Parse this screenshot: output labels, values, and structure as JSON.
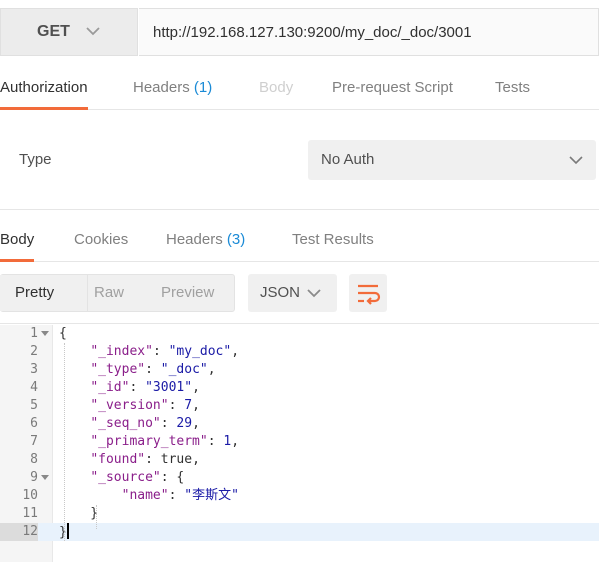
{
  "request": {
    "method": "GET",
    "url": "http://192.168.127.130:9200/my_doc/_doc/3001"
  },
  "request_tabs": [
    {
      "label": "Authorization",
      "count": "",
      "state": "active"
    },
    {
      "label": "Headers",
      "count": "(1)",
      "state": "normal"
    },
    {
      "label": "Body",
      "count": "",
      "state": "disabled"
    },
    {
      "label": "Pre-request Script",
      "count": "",
      "state": "normal"
    },
    {
      "label": "Tests",
      "count": "",
      "state": "normal"
    }
  ],
  "auth": {
    "type_label": "Type",
    "type_value": "No Auth"
  },
  "response_tabs": [
    {
      "label": "Body",
      "count": "",
      "state": "active"
    },
    {
      "label": "Cookies",
      "count": "",
      "state": "normal"
    },
    {
      "label": "Headers",
      "count": "(3)",
      "state": "normal"
    },
    {
      "label": "Test Results",
      "count": "",
      "state": "normal"
    }
  ],
  "toolbar": {
    "views": [
      "Pretty",
      "Raw",
      "Preview"
    ],
    "active_view": "Pretty",
    "format": "JSON",
    "wrap_icon": "wrap-lines-icon"
  },
  "response_body": {
    "lines": [
      {
        "n": "1",
        "fold": true,
        "tokens": [
          {
            "t": "{",
            "c": "b"
          }
        ]
      },
      {
        "n": "2",
        "fold": false,
        "tokens": [
          {
            "t": "    ",
            "c": "b"
          },
          {
            "t": "\"_index\"",
            "c": "k"
          },
          {
            "t": ": ",
            "c": "b"
          },
          {
            "t": "\"my_doc\"",
            "c": "s"
          },
          {
            "t": ",",
            "c": "b"
          }
        ]
      },
      {
        "n": "3",
        "fold": false,
        "tokens": [
          {
            "t": "    ",
            "c": "b"
          },
          {
            "t": "\"_type\"",
            "c": "k"
          },
          {
            "t": ": ",
            "c": "b"
          },
          {
            "t": "\"_doc\"",
            "c": "s"
          },
          {
            "t": ",",
            "c": "b"
          }
        ]
      },
      {
        "n": "4",
        "fold": false,
        "tokens": [
          {
            "t": "    ",
            "c": "b"
          },
          {
            "t": "\"_id\"",
            "c": "k"
          },
          {
            "t": ": ",
            "c": "b"
          },
          {
            "t": "\"3001\"",
            "c": "s"
          },
          {
            "t": ",",
            "c": "b"
          }
        ]
      },
      {
        "n": "5",
        "fold": false,
        "tokens": [
          {
            "t": "    ",
            "c": "b"
          },
          {
            "t": "\"_version\"",
            "c": "k"
          },
          {
            "t": ": ",
            "c": "b"
          },
          {
            "t": "7",
            "c": "n"
          },
          {
            "t": ",",
            "c": "b"
          }
        ]
      },
      {
        "n": "6",
        "fold": false,
        "tokens": [
          {
            "t": "    ",
            "c": "b"
          },
          {
            "t": "\"_seq_no\"",
            "c": "k"
          },
          {
            "t": ": ",
            "c": "b"
          },
          {
            "t": "29",
            "c": "n"
          },
          {
            "t": ",",
            "c": "b"
          }
        ]
      },
      {
        "n": "7",
        "fold": false,
        "tokens": [
          {
            "t": "    ",
            "c": "b"
          },
          {
            "t": "\"_primary_term\"",
            "c": "k"
          },
          {
            "t": ": ",
            "c": "b"
          },
          {
            "t": "1",
            "c": "n"
          },
          {
            "t": ",",
            "c": "b"
          }
        ]
      },
      {
        "n": "8",
        "fold": false,
        "tokens": [
          {
            "t": "    ",
            "c": "b"
          },
          {
            "t": "\"found\"",
            "c": "k"
          },
          {
            "t": ": ",
            "c": "b"
          },
          {
            "t": "true",
            "c": "b"
          },
          {
            "t": ",",
            "c": "b"
          }
        ]
      },
      {
        "n": "9",
        "fold": true,
        "tokens": [
          {
            "t": "    ",
            "c": "b"
          },
          {
            "t": "\"_source\"",
            "c": "k"
          },
          {
            "t": ": {",
            "c": "b"
          }
        ]
      },
      {
        "n": "10",
        "fold": false,
        "tokens": [
          {
            "t": "        ",
            "c": "b"
          },
          {
            "t": "\"name\"",
            "c": "k"
          },
          {
            "t": ": ",
            "c": "b"
          },
          {
            "t": "\"李斯文\"",
            "c": "s"
          }
        ]
      },
      {
        "n": "11",
        "fold": false,
        "tokens": [
          {
            "t": "    }",
            "c": "b"
          }
        ]
      },
      {
        "n": "12",
        "fold": false,
        "tokens": [
          {
            "t": "}",
            "c": "b"
          }
        ],
        "active": true
      }
    ]
  },
  "colors": {
    "accent": "#f26b3a",
    "count": "#1a8ad6"
  }
}
